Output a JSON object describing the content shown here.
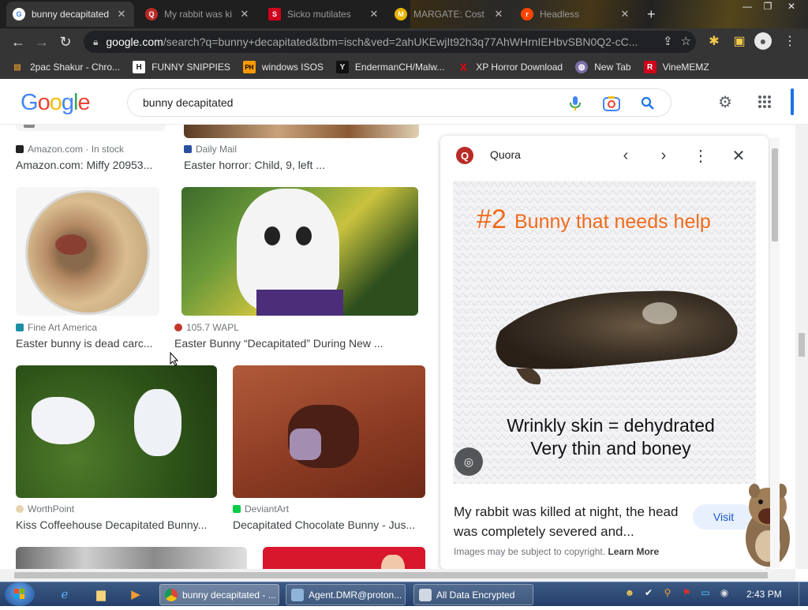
{
  "browser": {
    "tabs": [
      {
        "title": "bunny decapitated",
        "favicon": "G",
        "favicon_color": "#ffffff",
        "active": true
      },
      {
        "title": "My rabbit was ki",
        "favicon": "Q",
        "favicon_color": "#b92b27",
        "active": false
      },
      {
        "title": "Sicko mutilates",
        "favicon": "S",
        "favicon_color": "#d0021b",
        "active": false
      },
      {
        "title": "MARGATE: Cost",
        "favicon": "M",
        "favicon_color": "#e6b400",
        "active": false
      },
      {
        "title": "Headless",
        "favicon": "r",
        "favicon_color": "#ff4500",
        "active": false
      }
    ],
    "new_tab_symbol": "+",
    "window_controls": {
      "minimize": "—",
      "maximize": "❐",
      "close": "✕"
    },
    "nav": {
      "back": "←",
      "forward": "→",
      "reload": "↻"
    },
    "url": {
      "host": "google.com",
      "path": "/search?q=bunny+decapitated&tbm=isch&ved=2ahUKEwjIt92h3q77AhWHrnIEHbvSBN0Q2-cC..."
    },
    "bookmarks": [
      {
        "label": "2pac Shakur - Chro...",
        "icon": "scroll-icon",
        "icon_color": "#c98b2c"
      },
      {
        "label": "FUNNY SNIPPIES",
        "icon": "H",
        "icon_color": "#ffffff"
      },
      {
        "label": "windows ISOS",
        "icon": "PH",
        "icon_color": "#ff9900"
      },
      {
        "label": "EndermanCH/Malw...",
        "icon": "Y",
        "icon_color": "#e8e8e8"
      },
      {
        "label": "XP Horror Download",
        "icon": "X",
        "icon_color": "#e8000b"
      },
      {
        "label": "New Tab",
        "icon": "globe-icon",
        "icon_color": "#7a6fa8"
      },
      {
        "label": "VineMEMZ",
        "icon": "R",
        "icon_color": "#d0021b"
      }
    ]
  },
  "google": {
    "logo_letters": [
      {
        "ch": "G",
        "color": "#4285f4"
      },
      {
        "ch": "o",
        "color": "#ea4335"
      },
      {
        "ch": "o",
        "color": "#fbbc05"
      },
      {
        "ch": "g",
        "color": "#4285f4"
      },
      {
        "ch": "l",
        "color": "#34a853"
      },
      {
        "ch": "e",
        "color": "#ea4335"
      }
    ],
    "query": "bunny decapitated"
  },
  "results": [
    {
      "source": "Amazon.com · In stock",
      "title": "Amazon.com: Miffy 20953..."
    },
    {
      "source": "Daily Mail",
      "title": "Easter horror: Child, 9, left ..."
    },
    {
      "source": "Fine Art America",
      "title": "Easter bunny is dead carc..."
    },
    {
      "source": "105.7 WAPL",
      "title": "Easter Bunny “Decapitated” During New ..."
    },
    {
      "source": "WorthPoint",
      "title": "Kiss Coffeehouse Decapitated Bunny..."
    },
    {
      "source": "DeviantArt",
      "title": "Decapitated Chocolate Bunny - Jus..."
    }
  ],
  "panel": {
    "site": "Quora",
    "image_heading_num": "#2",
    "image_heading_text": "Bunny that needs help",
    "image_caption_1": "Wrinkly skin = dehydrated",
    "image_caption_2": "Very thin and boney",
    "caption": "My rabbit was killed at night, the head was completely severed and...",
    "visit_label": "Visit",
    "copyright_text": "Images may be subject to copyright.",
    "learn_more": "Learn More"
  },
  "taskbar": {
    "tasks": [
      {
        "label": "bunny decapitated - ...",
        "icon_color": "#e8e8e8",
        "active": true
      },
      {
        "label": "Agent.DMR@proton...",
        "icon_color": "#8fb3d9",
        "active": false
      },
      {
        "label": "All Data Encrypted",
        "icon_color": "#cfd8e3",
        "active": false
      }
    ],
    "clock": "2:43 PM"
  },
  "colors": {
    "accent_blue": "#1a73e8",
    "tab_dark": "#1f1f1f",
    "toolbar": "#353535"
  }
}
